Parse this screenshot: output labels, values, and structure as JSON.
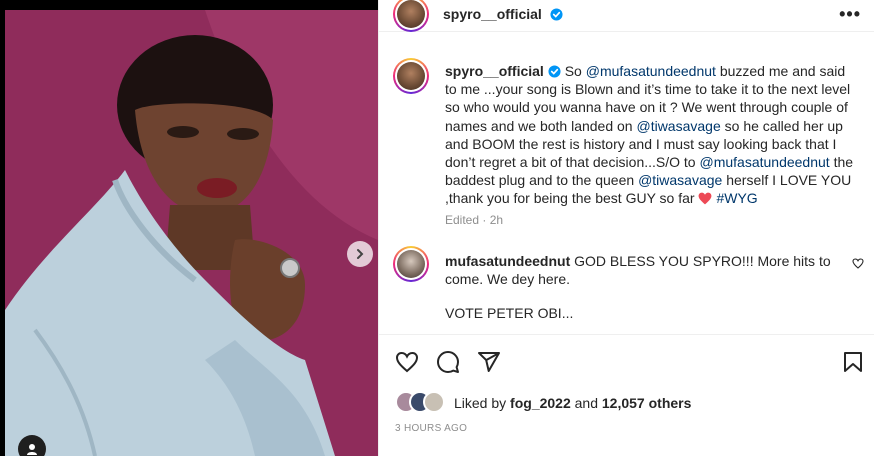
{
  "post": {
    "author": "spyro__official",
    "more_label": "•••"
  },
  "caption": {
    "author": "spyro__official",
    "part1": " So ",
    "mention1": "@mufasatundeednut",
    "part2": " buzzed me and said to me ...your song is Blown and it’s time to take it to the next level so who would you wanna have on it ? We went through couple of names and we both landed on ",
    "mention2": "@tiwasavage",
    "part3": " so he called her up and BOOM the rest is history and I must say looking back that I don’t regret a bit of that decision...S/O to ",
    "mention3": "@mufasatundeednut",
    "part4": " the baddest plug and to the queen ",
    "mention4": "@tiwasavage",
    "part5": " herself I LOVE YOU ,thank you for being the best GUY so far ",
    "hashtag": "#WYG",
    "edited": "Edited · 2h"
  },
  "comment": {
    "author": "mufasatundeednut",
    "text": "GOD BLESS YOU SPYRO!!! More hits to come. We dey here.",
    "text2": "VOTE PETER OBI..."
  },
  "likes": {
    "prefix": "Liked by ",
    "user": "fog_2022",
    "middle": " and ",
    "count": "12,057 others"
  },
  "timestamp": "3 HOURS AGO",
  "colors": {
    "mention": "#00376b",
    "verified": "#0095f6",
    "heart": "#ed4956"
  }
}
